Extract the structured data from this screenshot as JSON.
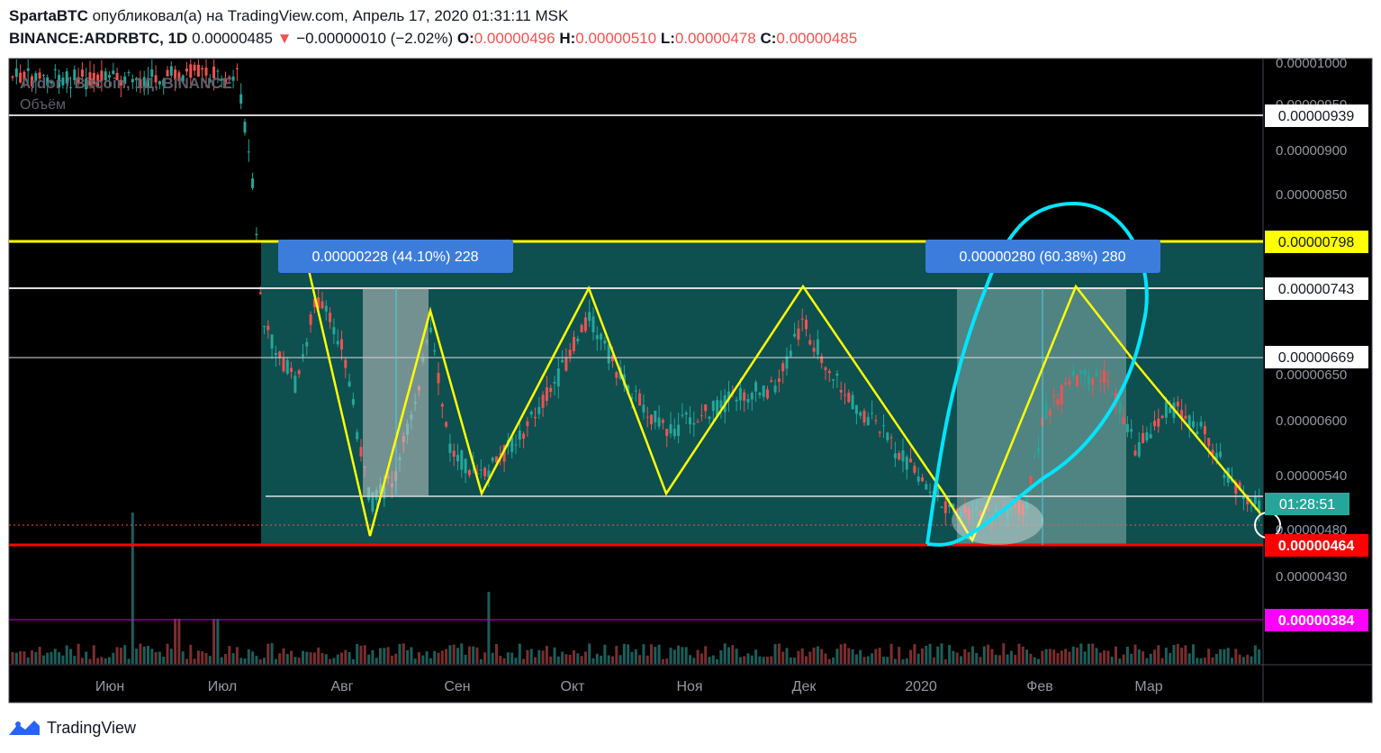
{
  "header": {
    "author": "SpartaBTC",
    "published_text": "опубликовал(а) на TradingView.com, Апрель 17, 2020 01:31:11 MSK",
    "symbol": "BINANCE:ARDRBTC, 1D",
    "last_price": "0.00000485",
    "change_arrow": "▼",
    "change": "−0.00000010 (−2.02%)",
    "open_label": "O:",
    "open": "0.00000496",
    "high_label": "H:",
    "high": "0.00000510",
    "low_label": "L:",
    "low": "0.00000478",
    "close_label": "C:",
    "close": "0.00000485"
  },
  "chart_legend": {
    "title": "Ardor / Bitcoin, 1Д, BINANCE",
    "volume": "Объём"
  },
  "price_axis": {
    "ticks": [
      "0.00001000",
      "0.00000950",
      "0.00000900",
      "0.00000850",
      "0.00000650",
      "0.00000600",
      "0.00000540",
      "0.00000480",
      "0.00000430"
    ]
  },
  "price_labels": [
    {
      "text": "0.00000939",
      "value": 9.39e-06,
      "bg": "#ffffff",
      "fg": "#131722"
    },
    {
      "text": "0.00000798",
      "value": 7.98e-06,
      "bg": "#ffff00",
      "fg": "#131722"
    },
    {
      "text": "0.00000743",
      "value": 7.43e-06,
      "bg": "#ffffff",
      "fg": "#131722"
    },
    {
      "text": "0.00000669",
      "value": 6.69e-06,
      "bg": "#ffffff",
      "fg": "#131722"
    },
    {
      "text": "01:28:51",
      "value": 5.4e-06,
      "bg": "#26a69a",
      "fg": "#ffffff"
    },
    {
      "text": "0.00000464",
      "value": 4.64e-06,
      "bg": "#ff0000",
      "fg": "#ffffff"
    },
    {
      "text": "0.00000384",
      "value": 3.84e-06,
      "bg": "#ff00ff",
      "fg": "#ffffff"
    }
  ],
  "measure_labels": [
    {
      "text": "0.00000228 (44.10%) 228"
    },
    {
      "text": "0.00000280 (60.38%) 280"
    }
  ],
  "time_axis": [
    "Июн",
    "Июл",
    "Авг",
    "Сен",
    "Окт",
    "Ноя",
    "Дек",
    "2020",
    "Фев",
    "Мар"
  ],
  "colors": {
    "background": "#000000",
    "up": "#26a69a",
    "down": "#ef5350",
    "range_fill": "#0e4f50",
    "zigzag": "#ffff00",
    "circle": "#00e5ff",
    "label_blue": "#3c7ddb"
  },
  "footer": {
    "brand": "TradingView"
  }
}
